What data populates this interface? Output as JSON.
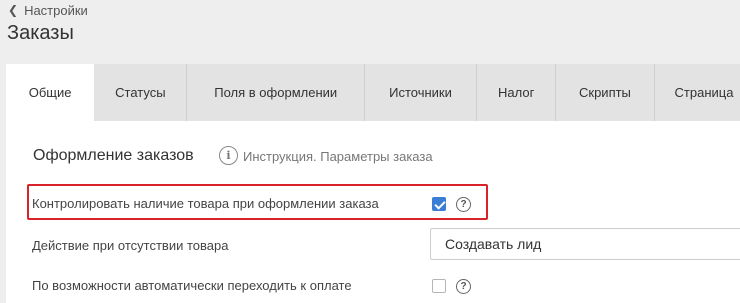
{
  "header": {
    "back_label": "Настройки",
    "title": "Заказы"
  },
  "tabs": [
    {
      "label": "Общие",
      "active": true
    },
    {
      "label": "Статусы",
      "active": false
    },
    {
      "label": "Поля в оформлении",
      "active": false
    },
    {
      "label": "Источники",
      "active": false
    },
    {
      "label": "Налог",
      "active": false
    },
    {
      "label": "Скрипты",
      "active": false
    },
    {
      "label": "Страница",
      "active": false
    }
  ],
  "section": {
    "title": "Оформление заказов",
    "info_link": "Инструкция. Параметры заказа"
  },
  "settings": [
    {
      "label": "Контролировать наличие товара при оформлении заказа",
      "control": "checkbox",
      "checked": true,
      "highlighted": true
    },
    {
      "label": "Действие при отсутствии товара",
      "control": "select",
      "value": "Создавать лид"
    },
    {
      "label": "По возможности автоматически переходить к оплате",
      "control": "checkbox",
      "checked": false
    }
  ],
  "icons": {
    "back": "chevron-left-icon",
    "info": "info-icon",
    "help": "question-circle-icon"
  },
  "colors": {
    "highlight": "#d9232a",
    "checkbox_checked": "#3a7fd5",
    "background": "#eeeeee",
    "tab_inactive": "#e3e3e3"
  }
}
